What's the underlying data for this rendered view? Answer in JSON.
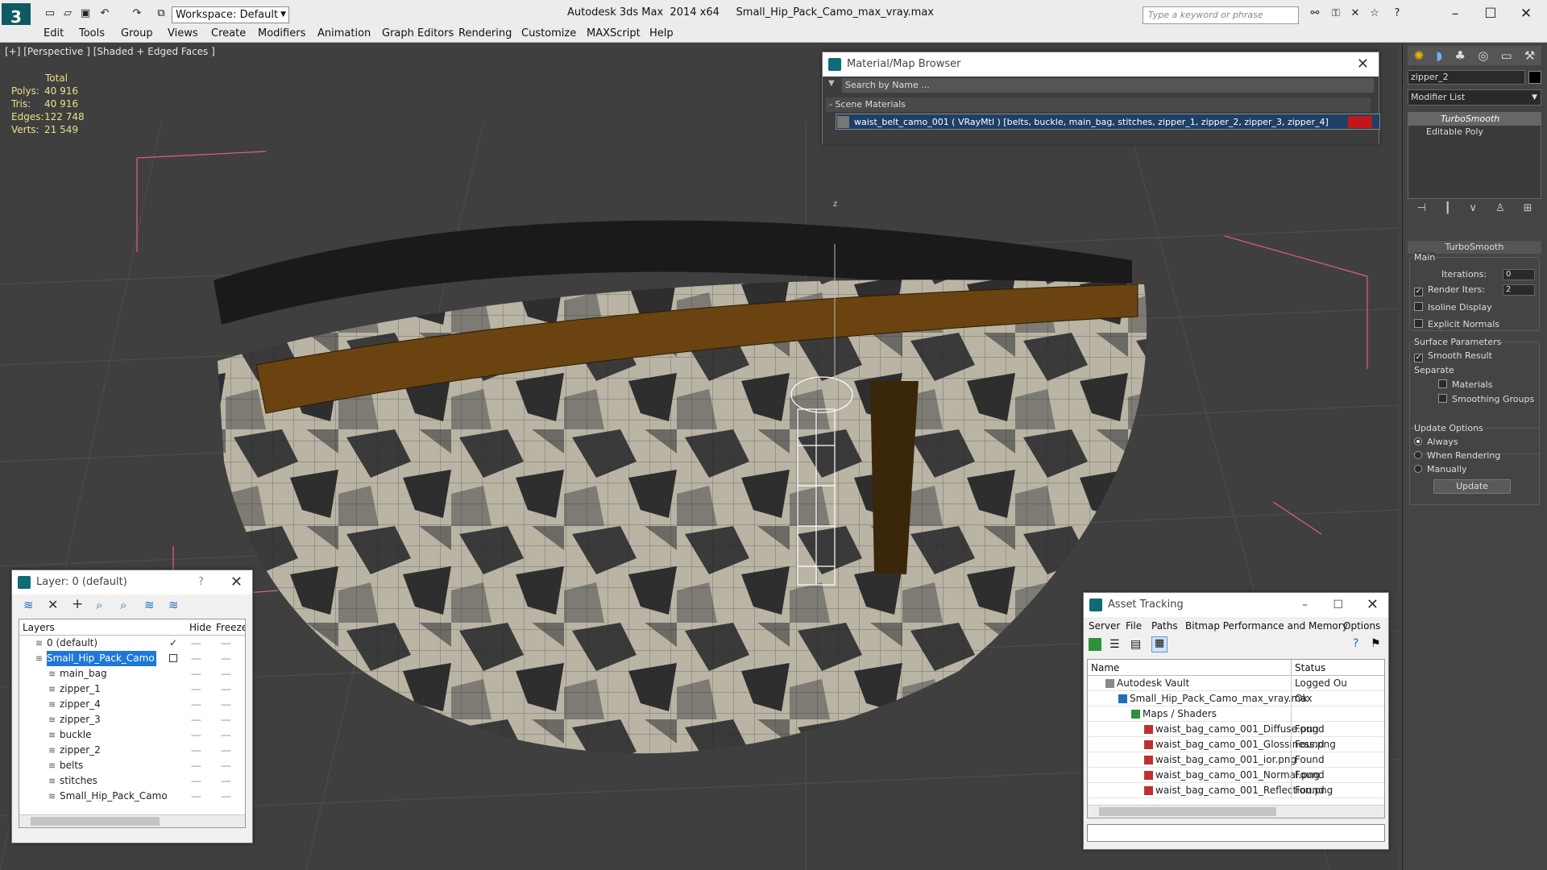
{
  "app": {
    "title": "Autodesk 3ds Max  2014 x64     Small_Hip_Pack_Camo_max_vray.max",
    "workspace": "Workspace: Default",
    "search_placeholder": "Type a keyword or phrase"
  },
  "menu": [
    "Edit",
    "Tools",
    "Group",
    "Views",
    "Create",
    "Modifiers",
    "Animation",
    "Graph Editors",
    "Rendering",
    "Customize",
    "MAXScript",
    "Help"
  ],
  "viewport": {
    "label": "[+] [Perspective ] [Shaded + Edged Faces ]",
    "stats_header": "Total",
    "stats": [
      {
        "k": "Polys:",
        "v": "40 916"
      },
      {
        "k": "Tris:",
        "v": "40 916"
      },
      {
        "k": "Edges:",
        "v": "122 748"
      },
      {
        "k": "Verts:",
        "v": "21 549"
      }
    ],
    "axis_z": "z"
  },
  "material_browser": {
    "title": "Material/Map Browser",
    "search": "Search by Name ...",
    "section": "- Scene Materials",
    "item": "waist_belt_camo_001  ( VRayMtl )  [belts, buckle, main_bag, stitches, zipper_1, zipper_2, zipper_3, zipper_4]"
  },
  "layer_panel": {
    "title": "Layer: 0 (default)",
    "help": "?",
    "headers": {
      "layers": "Layers",
      "hide": "Hide",
      "freeze": "Freeze"
    },
    "rows": [
      {
        "name": "0 (default)",
        "indent": 1,
        "selected": false,
        "check": true
      },
      {
        "name": "Small_Hip_Pack_Camo",
        "indent": 1,
        "selected": true,
        "check": false
      },
      {
        "name": "main_bag",
        "indent": 2,
        "selected": false,
        "check": false
      },
      {
        "name": "zipper_1",
        "indent": 2,
        "selected": false,
        "check": false
      },
      {
        "name": "zipper_4",
        "indent": 2,
        "selected": false,
        "check": false
      },
      {
        "name": "zipper_3",
        "indent": 2,
        "selected": false,
        "check": false
      },
      {
        "name": "buckle",
        "indent": 2,
        "selected": false,
        "check": false
      },
      {
        "name": "zipper_2",
        "indent": 2,
        "selected": false,
        "check": false
      },
      {
        "name": "belts",
        "indent": 2,
        "selected": false,
        "check": false
      },
      {
        "name": "stitches",
        "indent": 2,
        "selected": false,
        "check": false
      },
      {
        "name": "Small_Hip_Pack_Camo",
        "indent": 2,
        "selected": false,
        "check": false
      }
    ],
    "dash": "----"
  },
  "asset_tracking": {
    "title": "Asset Tracking",
    "menu": [
      "Server",
      "File",
      "Paths",
      "Bitmap Performance and Memory",
      "Options"
    ],
    "headers": {
      "name": "Name",
      "status": "Status"
    },
    "rows": [
      {
        "name": "Autodesk Vault",
        "status": "Logged Ou",
        "indent": 0,
        "icon": "vault"
      },
      {
        "name": "Small_Hip_Pack_Camo_max_vray.max",
        "status": "Ok",
        "indent": 1,
        "icon": "max"
      },
      {
        "name": "Maps / Shaders",
        "status": "",
        "indent": 2,
        "icon": "folder"
      },
      {
        "name": "waist_bag_camo_001_Diffuse.png",
        "status": "Found",
        "indent": 3,
        "icon": "png"
      },
      {
        "name": "waist_bag_camo_001_Glossiness.png",
        "status": "Found",
        "indent": 3,
        "icon": "png"
      },
      {
        "name": "waist_bag_camo_001_ior.png",
        "status": "Found",
        "indent": 3,
        "icon": "png"
      },
      {
        "name": "waist_bag_camo_001_Normal.png",
        "status": "Found",
        "indent": 3,
        "icon": "png"
      },
      {
        "name": "waist_bag_camo_001_Reflection.png",
        "status": "Found",
        "indent": 3,
        "icon": "png"
      }
    ]
  },
  "command_panel": {
    "object_name": "zipper_2",
    "modifier_list": "Modifier List",
    "stack": [
      "TurboSmooth",
      "Editable Poly"
    ],
    "rollout_title": "TurboSmooth",
    "main_label": "Main",
    "iterations_label": "Iterations:",
    "iterations": "0",
    "render_iters_label": "Render Iters:",
    "render_iters": "2",
    "isoline": "Isoline Display",
    "explicit_normals": "Explicit Normals",
    "surface_params": "Surface Parameters",
    "smooth_result": "Smooth Result",
    "separate": "Separate",
    "materials": "Materials",
    "smoothing_groups": "Smoothing Groups",
    "update_options": "Update Options",
    "always": "Always",
    "when_rendering": "When Rendering",
    "manually": "Manually",
    "update_button": "Update"
  },
  "colors": {
    "accent": "#1e78d7",
    "selected": "#1e78d7",
    "brand": "#0d5a63",
    "viewport_bg": "#3f3f3f"
  }
}
